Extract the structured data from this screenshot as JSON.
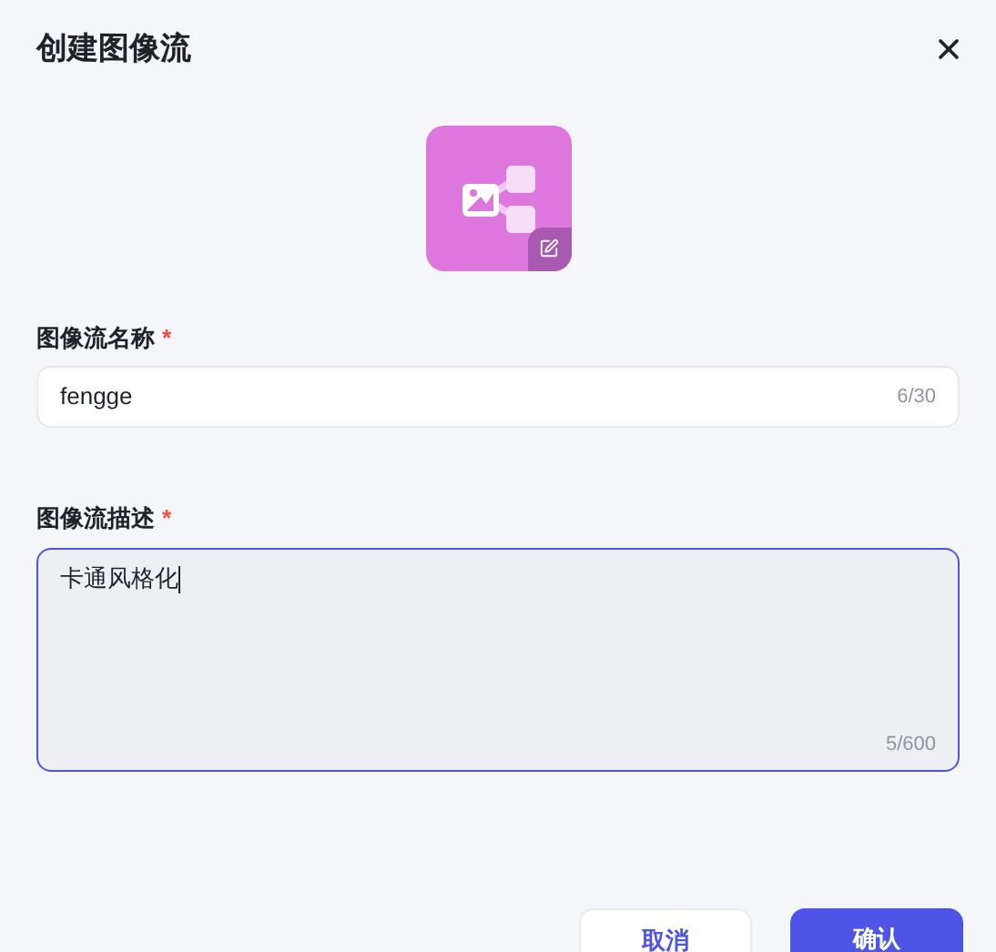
{
  "dialog": {
    "title": "创建图像流"
  },
  "name_field": {
    "label": "图像流名称",
    "required_mark": "*",
    "value": "fengge",
    "counter": "6/30",
    "focused": false
  },
  "description_field": {
    "label": "图像流描述",
    "required_mark": "*",
    "value": "卡通风格化",
    "counter": "5/600",
    "focused": true
  },
  "buttons": [
    {
      "label": "取消",
      "kind": "secondary"
    },
    {
      "label": "确认",
      "kind": "primary"
    }
  ]
}
